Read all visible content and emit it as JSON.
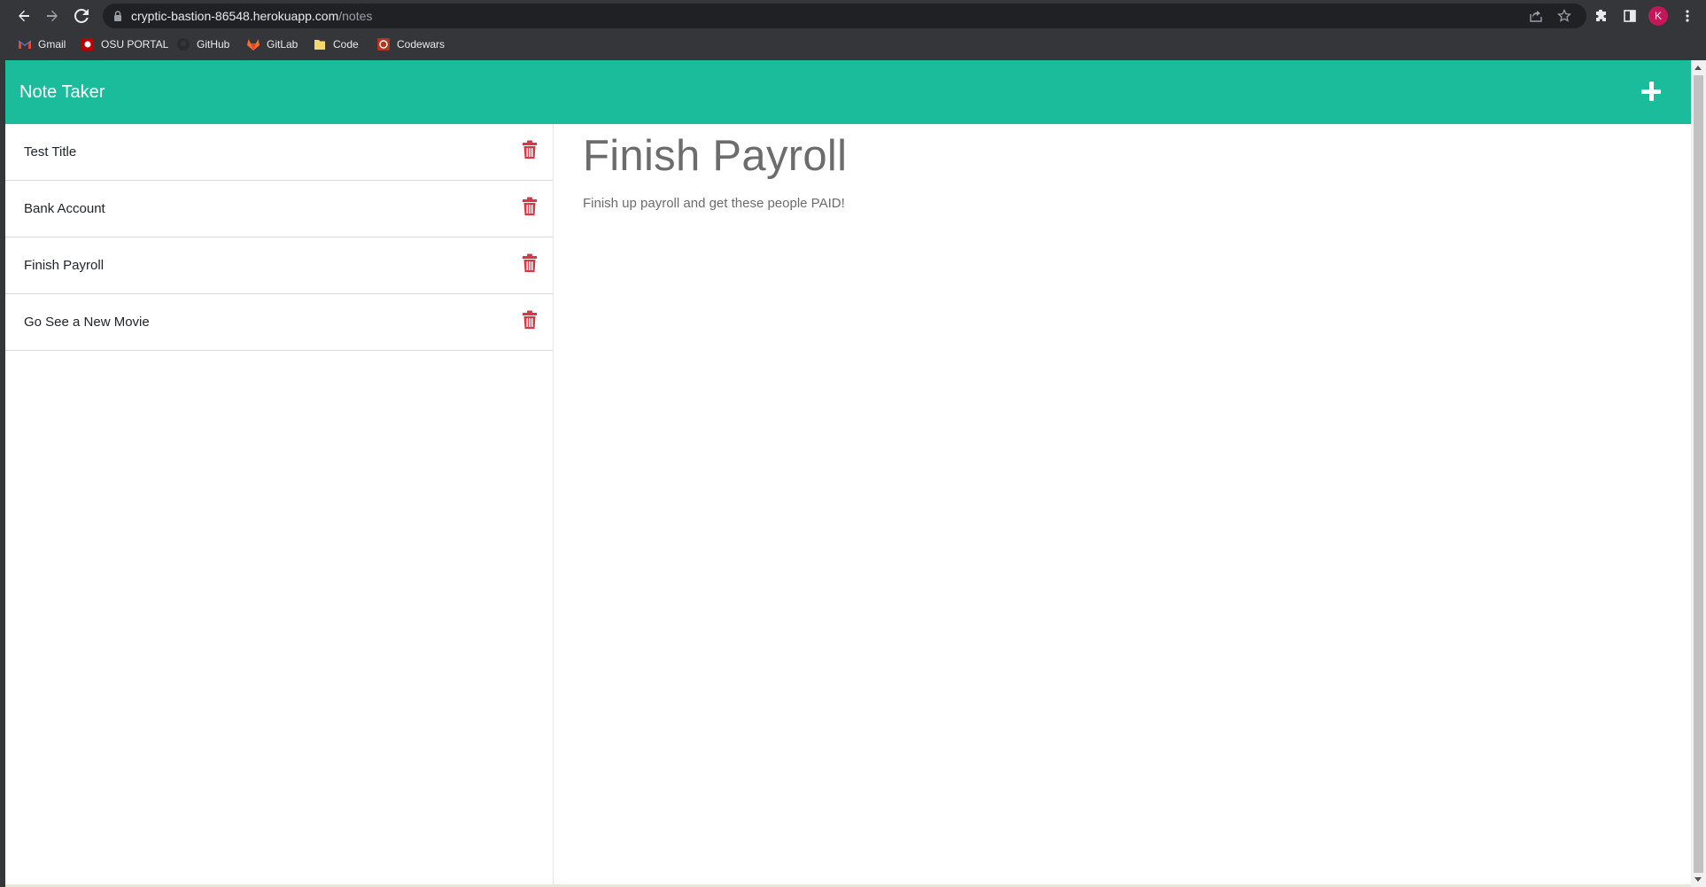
{
  "browser": {
    "url_host": "cryptic-bastion-86548.herokuapp.com",
    "url_path": "/notes",
    "profile_initial": "K",
    "bookmarks": [
      {
        "label": "Gmail",
        "icon": "gmail-icon"
      },
      {
        "label": "OSU PORTAL",
        "icon": "osu-icon"
      },
      {
        "label": "GitHub",
        "icon": "github-icon"
      },
      {
        "label": "GitLab",
        "icon": "gitlab-icon"
      },
      {
        "label": "Code",
        "icon": "folder-icon"
      },
      {
        "label": "Codewars",
        "icon": "codewars-icon"
      }
    ]
  },
  "app": {
    "title": "Note Taker",
    "accent_color": "#1abc9c",
    "delete_color": "#dc3545",
    "notes": [
      {
        "title": "Test Title"
      },
      {
        "title": "Bank Account"
      },
      {
        "title": "Finish Payroll"
      },
      {
        "title": "Go See a New Movie"
      }
    ],
    "active_note": {
      "title": "Finish Payroll",
      "text": "Finish up payroll and get these people PAID!"
    }
  }
}
